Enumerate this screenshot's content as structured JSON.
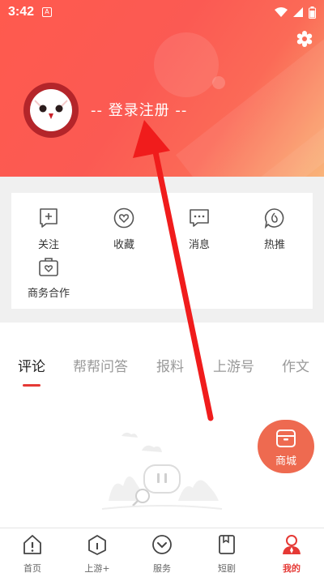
{
  "status_bar": {
    "time": "3:42",
    "app_icon_letter": "A"
  },
  "profile": {
    "login_text": "-- 登录注册 --"
  },
  "actions": [
    {
      "label": "关注",
      "icon": "follow-icon"
    },
    {
      "label": "收藏",
      "icon": "favorite-icon"
    },
    {
      "label": "消息",
      "icon": "message-icon"
    },
    {
      "label": "热推",
      "icon": "hot-push-icon"
    },
    {
      "label": "商务合作",
      "icon": "business-icon"
    }
  ],
  "tabs": [
    {
      "label": "评论",
      "active": true
    },
    {
      "label": "帮帮问答"
    },
    {
      "label": "报料"
    },
    {
      "label": "上游号"
    },
    {
      "label": "作文"
    }
  ],
  "mall": {
    "label": "商城"
  },
  "nav": [
    {
      "label": "首页",
      "icon": "home-icon"
    },
    {
      "label": "上游+",
      "icon": "upstream-plus-icon"
    },
    {
      "label": "服务",
      "icon": "service-icon"
    },
    {
      "label": "短剧",
      "icon": "short-drama-icon"
    },
    {
      "label": "我的",
      "icon": "profile-icon",
      "active": true
    }
  ],
  "colors": {
    "accent": "#e53935",
    "header_start": "#ff5a4e",
    "header_end": "#f9b072",
    "mall": "#ee6a50"
  }
}
